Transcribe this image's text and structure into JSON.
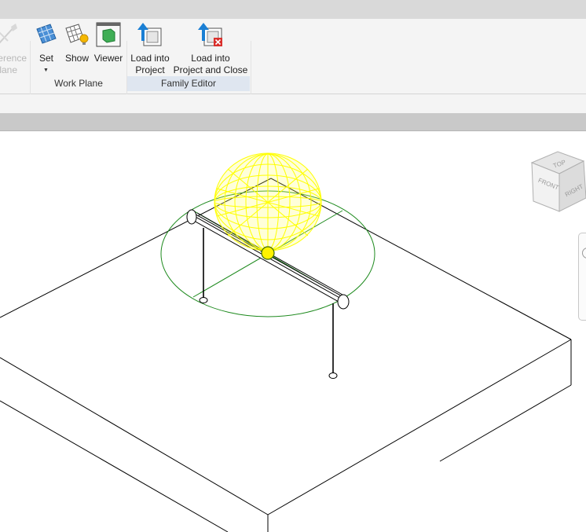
{
  "ribbon": {
    "tools": {
      "reference_plane": {
        "line1": "erence",
        "line2": "lane",
        "icon": "pencil-icon",
        "state": "disabled"
      },
      "set": {
        "label": "Set",
        "icon": "work-plane-grid-icon"
      },
      "show": {
        "label": "Show",
        "icon": "grid-bulb-icon"
      },
      "viewer": {
        "label": "Viewer",
        "icon": "viewer-cube-icon"
      },
      "load_into_project": {
        "line1": "Load into",
        "line2": "Project",
        "icon": "load-arrow-icon"
      },
      "load_into_project_close": {
        "line1": "Load into",
        "line2": "Project and Close",
        "icon": "load-close-icon"
      }
    },
    "panels": {
      "work_plane": "Work Plane",
      "family_editor": "Family Editor"
    }
  },
  "viewcube": {
    "top": "TOP",
    "front": "FRONT",
    "right": "RIGHT"
  },
  "colors": {
    "ribbon_bg": "#f4f4f4",
    "selection_highlight": "#ffff00",
    "reference_circle": "#1e8a1e",
    "model_lines": "#000000"
  }
}
